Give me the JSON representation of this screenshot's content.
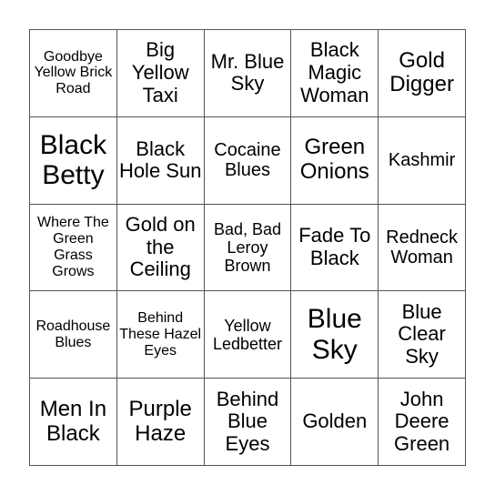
{
  "board": {
    "cells": [
      [
        "Goodbye Yellow Brick Road",
        "Big Yellow Taxi",
        "Mr. Blue Sky",
        "Black Magic Woman",
        "Gold Digger"
      ],
      [
        "Black Betty",
        "Black Hole Sun",
        "Cocaine Blues",
        "Green Onions",
        "Kashmir"
      ],
      [
        "Where The Green Grass Grows",
        "Gold on the Ceiling",
        "Bad, Bad Leroy Brown",
        "Fade To Black",
        "Redneck Woman"
      ],
      [
        "Roadhouse Blues",
        "Behind These Hazel Eyes",
        "Yellow Ledbetter",
        "Blue Sky",
        "Blue Clear Sky"
      ],
      [
        "Men In Black",
        "Purple Haze",
        "Behind Blue Eyes",
        "Golden",
        "John Deere Green"
      ]
    ]
  }
}
